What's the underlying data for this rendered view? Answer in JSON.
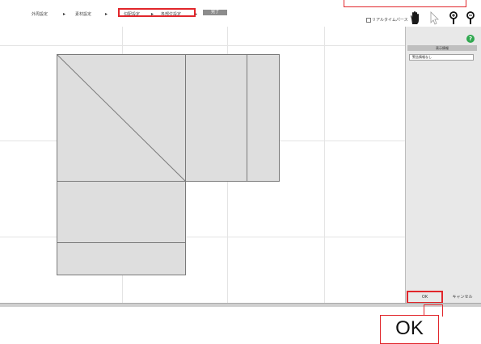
{
  "toolbar": {
    "steps": [
      "外周設定",
      "素材設定",
      "勾配設定",
      "各部位設定",
      "完了"
    ],
    "arrow": "▸",
    "realtime_label": "リアルタイムパース",
    "realtime_checked": false,
    "tools": [
      "hand-icon",
      "pointer-icon",
      "zoom-in-icon",
      "zoom-out-icon"
    ]
  },
  "panel": {
    "header": "表示情報",
    "field_value": "警告情報なし",
    "help_label": "?",
    "ok_label": "OK",
    "cancel_label": "キャンセル"
  },
  "callout": {
    "label": "OK"
  },
  "colors": {
    "highlight": "#e1262b",
    "shape_fill": "#dedede",
    "help_green": "#2fa84f"
  }
}
